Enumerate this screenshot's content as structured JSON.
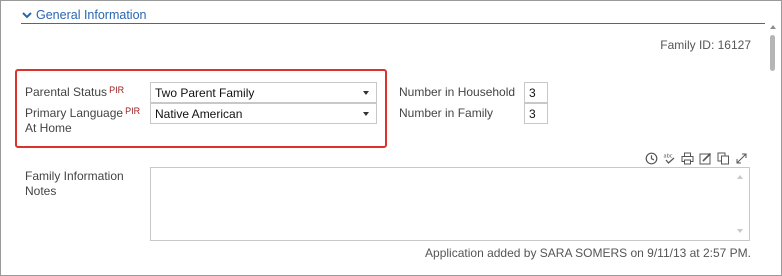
{
  "section": {
    "title": "General Information",
    "chevron_icon": "chevron-down-icon",
    "accent_color": "#2a66b0"
  },
  "family_id": "Family ID: 16127",
  "pir_highlight_color": "#d9342b",
  "fields": {
    "parental_status": {
      "label": "Parental Status",
      "pir": "PIR",
      "value": "Two Parent Family"
    },
    "primary_language": {
      "label_line1": "Primary Language",
      "label_line2": "At Home",
      "pir": "PIR",
      "value": "Native American"
    },
    "number_in_household": {
      "label": "Number in Household",
      "value": "3"
    },
    "number_in_family": {
      "label": "Number in Family",
      "value": "3"
    }
  },
  "notes": {
    "label_line1": "Family Information",
    "label_line2": "Notes",
    "value": "",
    "toolbar_icons": [
      "clock-icon",
      "spellcheck-icon",
      "print-icon",
      "edit-icon",
      "copy-icon",
      "expand-icon"
    ]
  },
  "footer": "Application added by SARA SOMERS on 9/11/13 at 2:57 PM."
}
